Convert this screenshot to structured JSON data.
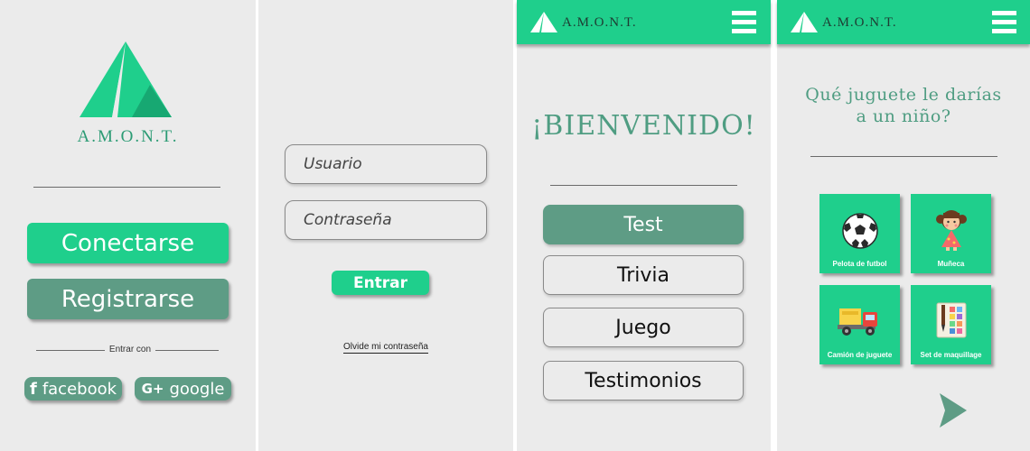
{
  "colors": {
    "accent": "#1fcf8c",
    "dark_accent": "#5e9c85",
    "title_green": "#4f9d82",
    "background": "#ebebeb"
  },
  "screen1": {
    "brand": "A.M.O.N.T.",
    "connect_label": "Conectarse",
    "register_label": "Registrarse",
    "enter_with": "Entrar con",
    "facebook_label": "facebook",
    "google_label": "google",
    "facebook_icon": "f",
    "google_icon": "G+"
  },
  "screen2": {
    "user_placeholder": "Usuario",
    "password_placeholder": "Contraseña",
    "enter_label": "Entrar",
    "forgot_label": "Olvide mi contraseña"
  },
  "screen3": {
    "brand": "A.M.O.N.T.",
    "welcome": "¡BIENVENIDO!",
    "menu": [
      {
        "label": "Test"
      },
      {
        "label": "Trivia"
      },
      {
        "label": "Juego"
      },
      {
        "label": "Testimonios"
      }
    ]
  },
  "screen4": {
    "brand": "A.M.O.N.T.",
    "question_line1": "Qué juguete le darías",
    "question_line2": "a un niño?",
    "options": [
      {
        "label": "Pelota de futbol",
        "icon": "soccer-ball-icon"
      },
      {
        "label": "Muñeca",
        "icon": "doll-icon"
      },
      {
        "label": "Camión de juguete",
        "icon": "toy-truck-icon"
      },
      {
        "label": "Set de maquillage",
        "icon": "makeup-set-icon"
      }
    ]
  }
}
